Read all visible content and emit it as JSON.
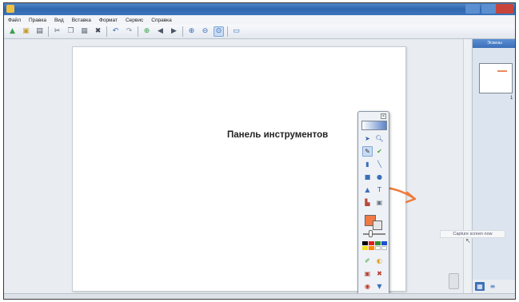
{
  "window": {
    "title": "",
    "brand_color": "#2f67b0"
  },
  "menu": [
    {
      "label": "Файл"
    },
    {
      "label": "Правка"
    },
    {
      "label": "Вид"
    },
    {
      "label": "Вставка"
    },
    {
      "label": "Формат"
    },
    {
      "label": "Сервис"
    },
    {
      "label": "Справка"
    }
  ],
  "toolbar": {
    "buttons": [
      {
        "icon": "open-folder-icon",
        "glyph": "▲",
        "color": "#3aa04a"
      },
      {
        "icon": "save-icon",
        "glyph": "▣",
        "color": "#c89b2b"
      },
      {
        "icon": "print-icon",
        "glyph": "▤",
        "color": "#4a5563"
      },
      {
        "icon": "cut-icon",
        "glyph": "✂",
        "color": "#4a5563"
      },
      {
        "icon": "copy-icon",
        "glyph": "❐",
        "color": "#6a7785"
      },
      {
        "icon": "paste-icon",
        "glyph": "▦",
        "color": "#6a7785"
      },
      {
        "icon": "delete-icon",
        "glyph": "✖",
        "color": "#3b4452"
      },
      {
        "icon": "undo-icon",
        "glyph": "↶",
        "color": "#3b6fb8"
      },
      {
        "icon": "redo-icon",
        "glyph": "↷",
        "color": "#8a95a3"
      },
      {
        "icon": "new-page-icon",
        "glyph": "⊕",
        "color": "#3aa04a"
      },
      {
        "icon": "previous-page-icon",
        "glyph": "◀",
        "color": "#4a5563"
      },
      {
        "icon": "next-page-icon",
        "glyph": "▶",
        "color": "#4a5563"
      },
      {
        "icon": "zoom-in-icon",
        "glyph": "⊕",
        "color": "#3b6fb8"
      },
      {
        "icon": "zoom-out-icon",
        "glyph": "⊖",
        "color": "#3b6fb8"
      },
      {
        "icon": "zoom-fit-icon",
        "glyph": "⊙",
        "color": "#3b6fb8",
        "active": true
      },
      {
        "icon": "screen-capture-icon",
        "glyph": "▭",
        "color": "#3b6fb8"
      }
    ]
  },
  "canvas": {
    "annotation_label": "Панель инструментов",
    "arrow_color": "#f07a3c"
  },
  "tools_panel": {
    "close_glyph": "×",
    "tools": [
      {
        "icon": "select-arrow-icon",
        "glyph": "➤",
        "color": "#2f5ea8"
      },
      {
        "icon": "zoom-tool-icon",
        "glyph": "🔍︎",
        "color": "#2f5ea8"
      },
      {
        "icon": "pen-icon",
        "glyph": "✎",
        "color": "#333333",
        "selected": true
      },
      {
        "icon": "highlighter-icon",
        "glyph": "✔",
        "color": "#48a23a"
      },
      {
        "icon": "eraser-icon",
        "glyph": "▮",
        "color": "#3b6fb8"
      },
      {
        "icon": "line-icon",
        "glyph": "╲",
        "color": "#3b6fb8"
      },
      {
        "icon": "rectangle-icon",
        "glyph": "■",
        "color": "#3b6fb8"
      },
      {
        "icon": "ellipse-icon",
        "glyph": "●",
        "color": "#3b6fb8"
      },
      {
        "icon": "triangle-icon",
        "glyph": "▲",
        "color": "#3b6fb8"
      },
      {
        "icon": "text-icon",
        "glyph": "T",
        "color": "#2f5ea8"
      },
      {
        "icon": "fill-icon",
        "glyph": "▙",
        "color": "#b5483a"
      },
      {
        "icon": "shapes-icon",
        "glyph": "▣",
        "color": "#6a7785"
      }
    ],
    "current_color": "#f07a44",
    "palette": [
      "#000000",
      "#e02020",
      "#2f8f2f",
      "#2050d0",
      "#f0e020",
      "#ff8800",
      "#ffffff",
      "#ffffff"
    ],
    "extra_tools": [
      {
        "icon": "magic-pen-icon",
        "glyph": "✐",
        "color": "#3aa04a"
      },
      {
        "icon": "creative-pen-icon",
        "glyph": "◐",
        "color": "#e0a020"
      },
      {
        "icon": "properties-icon",
        "glyph": "▣",
        "color": "#b5483a"
      },
      {
        "icon": "clear-icon",
        "glyph": "✖",
        "color": "#c0392b"
      },
      {
        "icon": "record-icon",
        "glyph": "◉",
        "color": "#c0392b"
      },
      {
        "icon": "screen-shade-icon",
        "glyph": "▼",
        "color": "#3b6fb8"
      },
      {
        "icon": "capture-icon",
        "glyph": "▤",
        "color": "#6a7785"
      },
      {
        "icon": "gallery-icon",
        "glyph": "▙",
        "color": "#3aa04a"
      }
    ]
  },
  "right_panel": {
    "header": "Эскизы",
    "page_number": "1"
  },
  "tooltip": {
    "text": "Capture screen now"
  }
}
